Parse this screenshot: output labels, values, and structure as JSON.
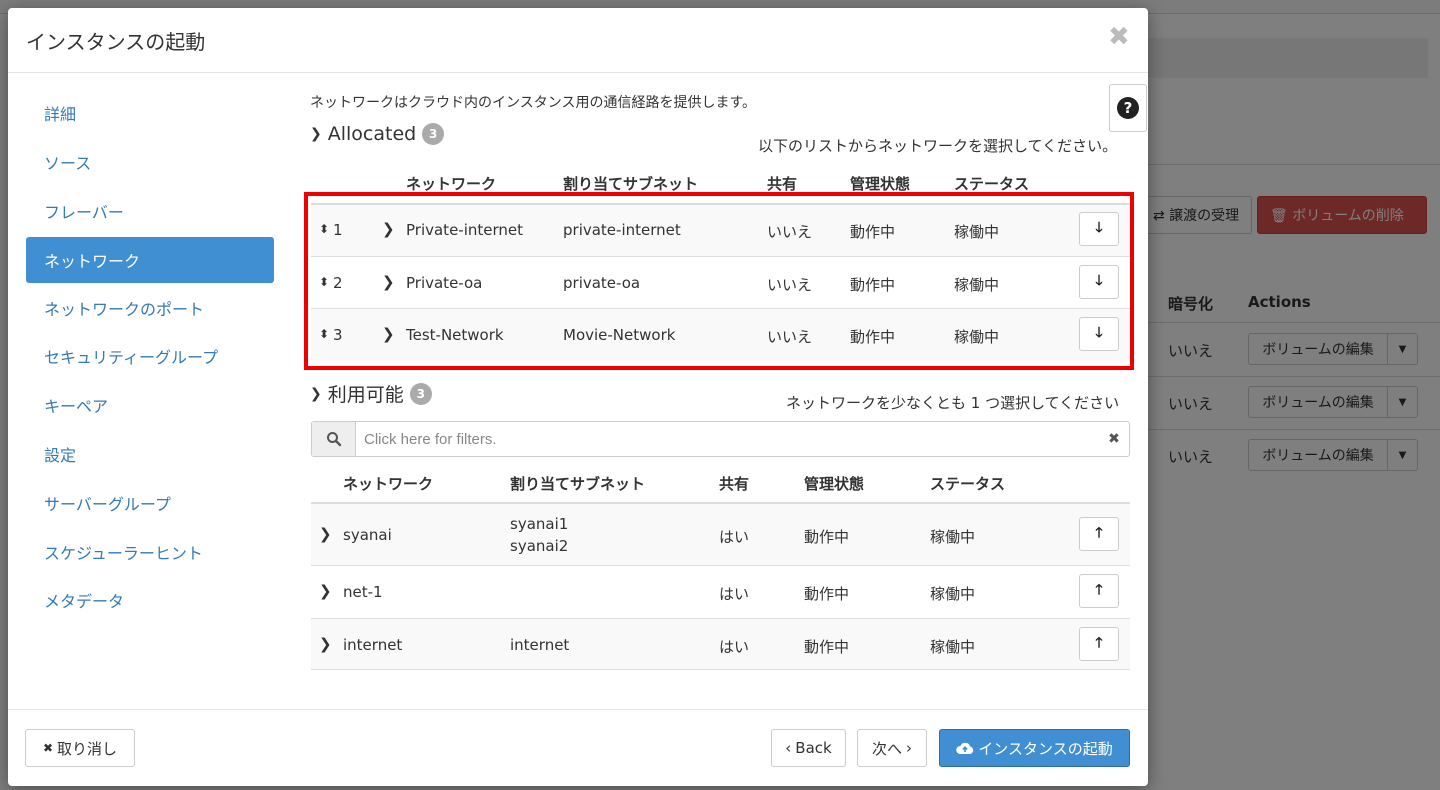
{
  "background": {
    "transfer_button": "⇄ 譲渡の受理",
    "delete_button": "🗑 ボリュームの削除",
    "col_encryption": "暗号化",
    "col_actions": "Actions",
    "rows": [
      {
        "encryption": "いいえ",
        "action": "ボリュームの編集"
      },
      {
        "encryption": "いいえ",
        "action": "ボリュームの編集"
      },
      {
        "encryption": "いいえ",
        "action": "ボリュームの編集"
      }
    ]
  },
  "modal": {
    "title": "インスタンスの起動",
    "close_icon": "✖"
  },
  "sidebar": {
    "items": [
      {
        "label": "詳細"
      },
      {
        "label": "ソース"
      },
      {
        "label": "フレーバー"
      },
      {
        "label": "ネットワーク",
        "active": true
      },
      {
        "label": "ネットワークのポート"
      },
      {
        "label": "セキュリティーグループ"
      },
      {
        "label": "キーペア"
      },
      {
        "label": "設定"
      },
      {
        "label": "サーバーグループ"
      },
      {
        "label": "スケジューラーヒント"
      },
      {
        "label": "メタデータ"
      }
    ]
  },
  "content": {
    "intro": "ネットワークはクラウド内のインスタンス用の通信経路を提供します。",
    "help_icon": "?"
  },
  "allocated": {
    "title": "Allocated",
    "count": "3",
    "hint": "以下のリストからネットワークを選択してください。",
    "headers": {
      "network": "ネットワーク",
      "subnet": "割り当てサブネット",
      "shared": "共有",
      "admin_state": "管理状態",
      "status": "ステータス"
    },
    "rows": [
      {
        "order": "1",
        "network": "Private-internet",
        "subnet": "private-internet",
        "shared": "いいえ",
        "admin_state": "動作中",
        "status": "稼働中"
      },
      {
        "order": "2",
        "network": "Private-oa",
        "subnet": "private-oa",
        "shared": "いいえ",
        "admin_state": "動作中",
        "status": "稼働中"
      },
      {
        "order": "3",
        "network": "Test-Network",
        "subnet": "Movie-Network",
        "shared": "いいえ",
        "admin_state": "動作中",
        "status": "稼働中"
      }
    ]
  },
  "available": {
    "title": "利用可能",
    "count": "3",
    "hint": "ネットワークを少なくとも 1 つ選択してください",
    "filter_placeholder": "Click here for filters.",
    "headers": {
      "network": "ネットワーク",
      "subnet": "割り当てサブネット",
      "shared": "共有",
      "admin_state": "管理状態",
      "status": "ステータス"
    },
    "rows": [
      {
        "network": "syanai",
        "subnet1": "syanai1",
        "subnet2": "syanai2",
        "shared": "はい",
        "admin_state": "動作中",
        "status": "稼働中"
      },
      {
        "network": "net-1",
        "subnet1": "",
        "subnet2": "",
        "shared": "はい",
        "admin_state": "動作中",
        "status": "稼働中"
      },
      {
        "network": "internet",
        "subnet1": "internet",
        "subnet2": "",
        "shared": "はい",
        "admin_state": "動作中",
        "status": "稼働中"
      }
    ]
  },
  "footer": {
    "cancel": "取り消し",
    "back": "Back",
    "next": "次へ",
    "launch": "インスタンスの起動"
  }
}
